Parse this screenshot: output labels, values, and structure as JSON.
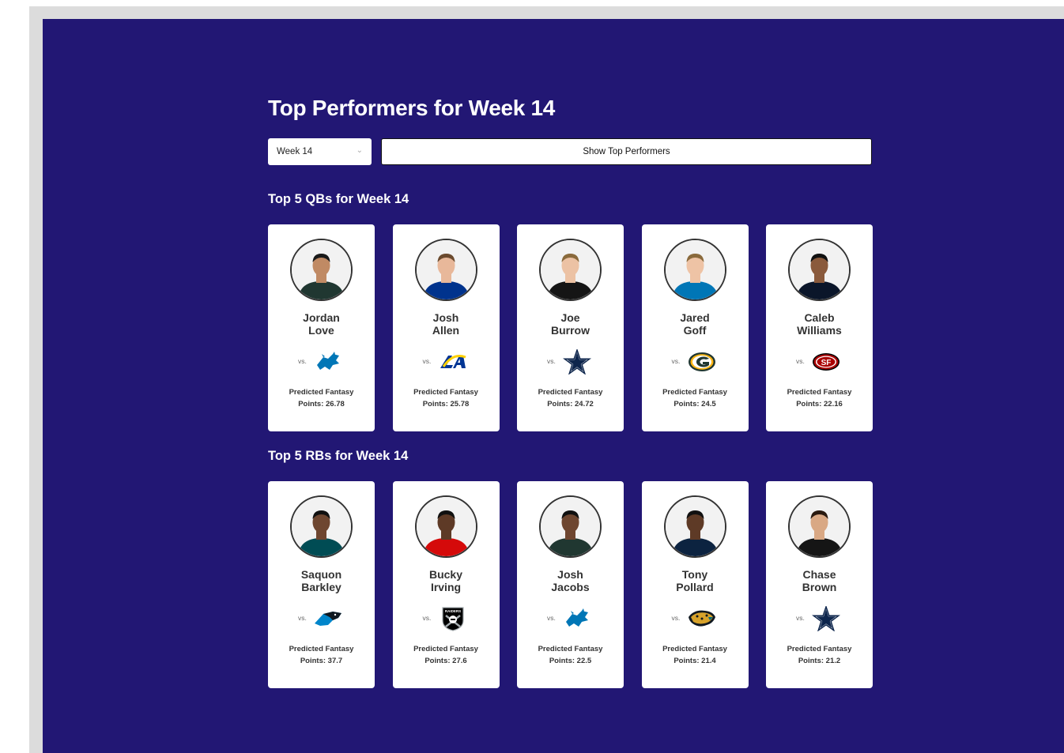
{
  "page": {
    "title": "Top Performers for Week 14",
    "week_select": {
      "value": "Week 14"
    },
    "show_button": "Show Top Performers"
  },
  "sections": [
    {
      "title": "Top 5 QBs for Week 14",
      "players": [
        {
          "first": "Jordan",
          "last": "Love",
          "vs": "vs.",
          "opponent_icon": "lions-logo-icon",
          "points_label": "Predicted Fantasy",
          "points": "Points: 26.78",
          "jersey": "#203731",
          "skin": "#c08a64",
          "hair": "#1a1a1a"
        },
        {
          "first": "Josh",
          "last": "Allen",
          "vs": "vs.",
          "opponent_icon": "rams-logo-icon",
          "points_label": "Predicted Fantasy",
          "points": "Points: 25.78",
          "jersey": "#00338d",
          "skin": "#e8b89a",
          "hair": "#6b4a2e"
        },
        {
          "first": "Joe",
          "last": "Burrow",
          "vs": "vs.",
          "opponent_icon": "cowboys-logo-icon",
          "points_label": "Predicted Fantasy",
          "points": "Points: 24.72",
          "jersey": "#151515",
          "skin": "#ecc2a4",
          "hair": "#8a6a3c"
        },
        {
          "first": "Jared",
          "last": "Goff",
          "vs": "vs.",
          "opponent_icon": "packers-logo-icon",
          "points_label": "Predicted Fantasy",
          "points": "Points: 24.5",
          "jersey": "#0076b6",
          "skin": "#eec3a5",
          "hair": "#8a6a3c"
        },
        {
          "first": "Caleb",
          "last": "Williams",
          "vs": "vs.",
          "opponent_icon": "49ers-logo-icon",
          "points_label": "Predicted Fantasy",
          "points": "Points: 22.16",
          "jersey": "#0b162a",
          "skin": "#8a5a3c",
          "hair": "#111111"
        }
      ]
    },
    {
      "title": "Top 5 RBs for Week 14",
      "players": [
        {
          "first": "Saquon",
          "last": "Barkley",
          "vs": "vs.",
          "opponent_icon": "panthers-logo-icon",
          "points_label": "Predicted Fantasy",
          "points": "Points: 37.7",
          "jersey": "#004c54",
          "skin": "#6e4630",
          "hair": "#111111"
        },
        {
          "first": "Bucky",
          "last": "Irving",
          "vs": "vs.",
          "opponent_icon": "raiders-logo-icon",
          "points_label": "Predicted Fantasy",
          "points": "Points: 27.6",
          "jersey": "#d50a0a",
          "skin": "#5e3a26",
          "hair": "#111111"
        },
        {
          "first": "Josh",
          "last": "Jacobs",
          "vs": "vs.",
          "opponent_icon": "lions-logo-icon",
          "points_label": "Predicted Fantasy",
          "points": "Points: 22.5",
          "jersey": "#203731",
          "skin": "#6e4630",
          "hair": "#111111"
        },
        {
          "first": "Tony",
          "last": "Pollard",
          "vs": "vs.",
          "opponent_icon": "jaguars-logo-icon",
          "points_label": "Predicted Fantasy",
          "points": "Points: 21.4",
          "jersey": "#0c2340",
          "skin": "#5e3a26",
          "hair": "#111111"
        },
        {
          "first": "Chase",
          "last": "Brown",
          "vs": "vs.",
          "opponent_icon": "cowboys-logo-icon",
          "points_label": "Predicted Fantasy",
          "points": "Points: 21.2",
          "jersey": "#151515",
          "skin": "#d9a884",
          "hair": "#2a1a10"
        }
      ]
    }
  ],
  "colors": {
    "background": "#221774",
    "card": "#ffffff",
    "text_dark": "#333333"
  }
}
